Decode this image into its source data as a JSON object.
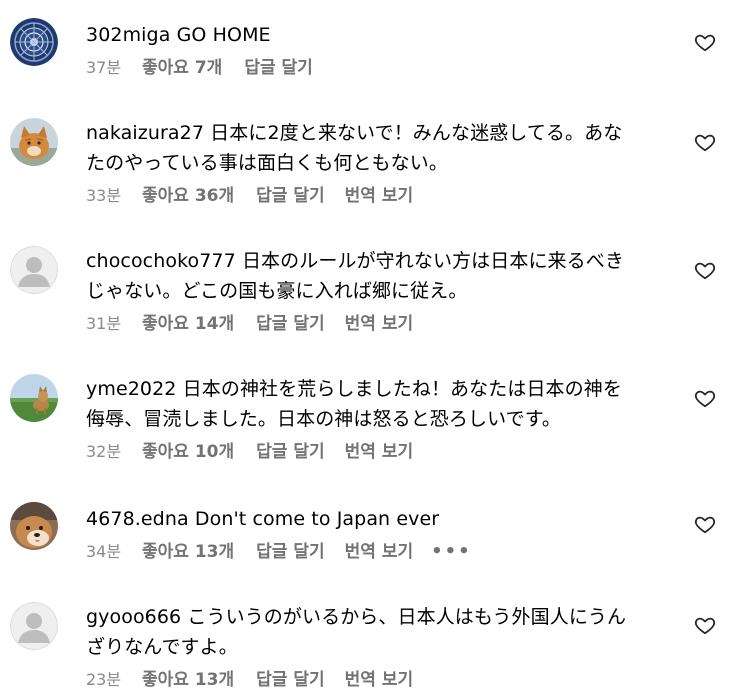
{
  "labels": {
    "like_prefix": "좋아요",
    "reply": "답글 달기",
    "translate": "번역 보기",
    "more": "•••"
  },
  "comments": [
    {
      "username": "302miga",
      "text": "GO HOME",
      "time": "37분",
      "likes": "좋아요 7개",
      "avatar": "mandala-logo-avatar",
      "show_translate": false,
      "show_more": false
    },
    {
      "username": "nakaizura27",
      "text_line1": "日本に2度と来ないで！みんな迷惑してる。あな",
      "text_line2": "たのやっている事は面白くも何ともない。",
      "time": "33분",
      "likes": "좋아요 36개",
      "avatar": "cat-photo-avatar"
    },
    {
      "username": "chocochoko777",
      "text_line1": "日本のルールが守れない方は日本に来るべき",
      "text_line2": "じゃない。どこの国も豪に入れば郷に従え。",
      "time": "31분",
      "likes": "좋아요 14개",
      "avatar": "default-user-avatar"
    },
    {
      "username": "yme2022",
      "text_line1": "日本の神社を荒らしましたね！あなたは日本の神を",
      "text_line2": "侮辱、冒涜しました。日本の神は怒ると恐ろしいです。",
      "time": "32분",
      "likes": "좋아요 10개",
      "avatar": "dog-field-photo-avatar"
    },
    {
      "username": "4678.edna",
      "text": "Don't come to Japan ever",
      "time": "34분",
      "likes": "좋아요 13개",
      "avatar": "shiba-dog-photo-avatar"
    },
    {
      "username": "gyooo666",
      "text_line1": "こういうのがいるから、日本人はもう外国人にうん",
      "text_line2": "ざりなんですよ。",
      "time": "23분",
      "likes": "좋아요 13개",
      "avatar": "default-user-avatar"
    }
  ]
}
